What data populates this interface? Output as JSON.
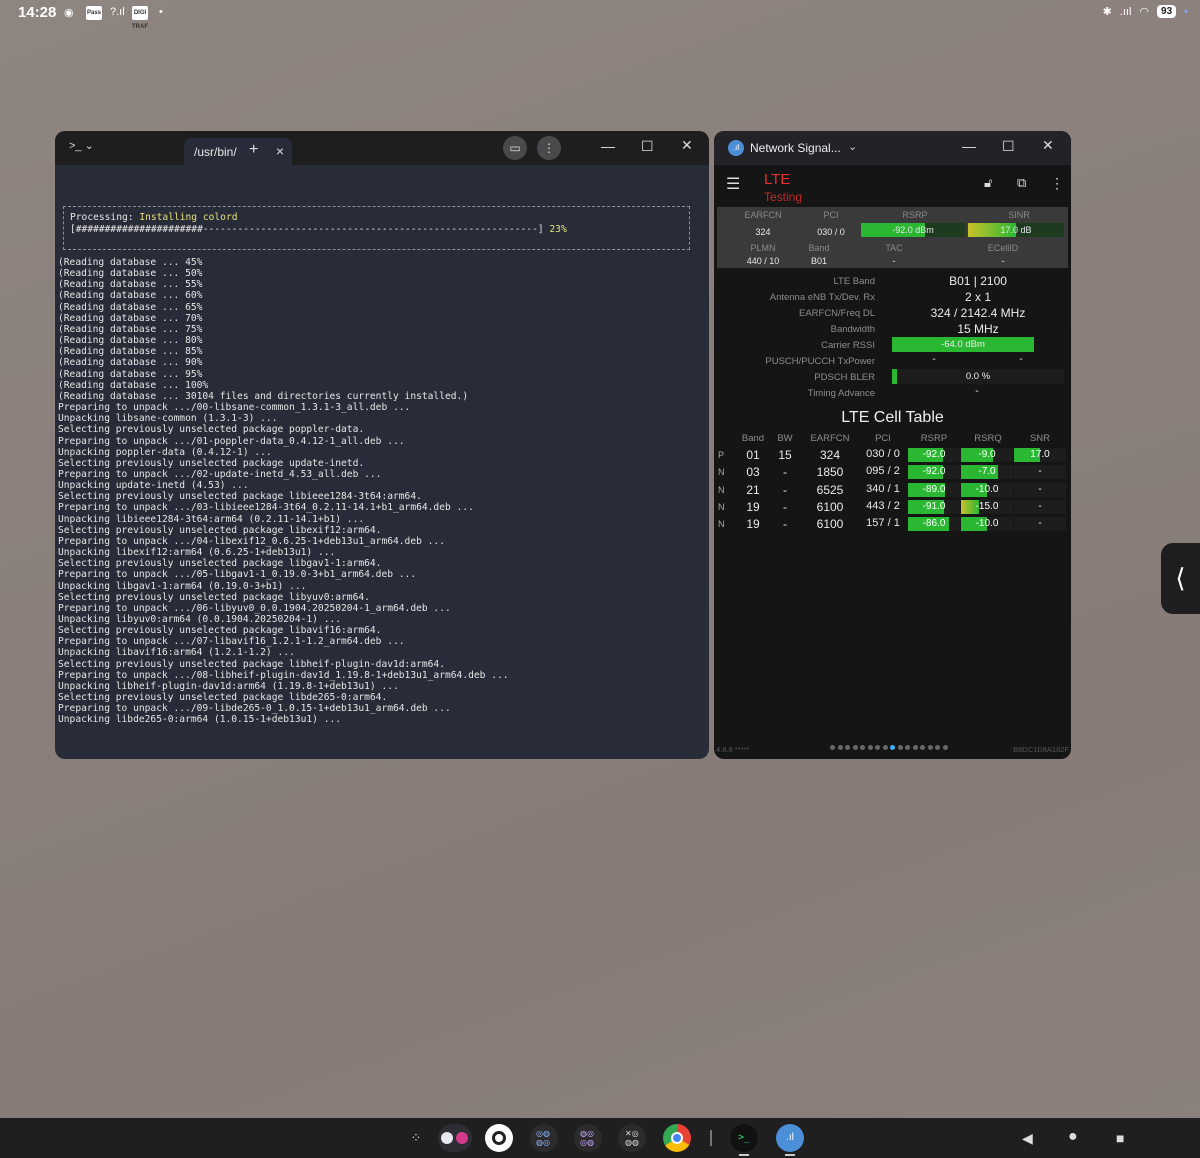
{
  "status_bar": {
    "time": "14:28",
    "battery": "93",
    "notif_labels": [
      "Pass",
      "DIGI\nTRAF"
    ]
  },
  "terminal": {
    "tab_label": "/usr/bin/",
    "new_tab": "+",
    "processing_label": "Processing: ",
    "processing_value": "Installing colord",
    "progress_bar": "[######################----------------------------------------------------------] ",
    "progress_pct": "23%",
    "log": "(Reading database ... 45%\n(Reading database ... 50%\n(Reading database ... 55%\n(Reading database ... 60%\n(Reading database ... 65%\n(Reading database ... 70%\n(Reading database ... 75%\n(Reading database ... 80%\n(Reading database ... 85%\n(Reading database ... 90%\n(Reading database ... 95%\n(Reading database ... 100%\n(Reading database ... 30104 files and directories currently installed.)\nPreparing to unpack .../00-libsane-common_1.3.1-3_all.deb ...\nUnpacking libsane-common (1.3.1-3) ...\nSelecting previously unselected package poppler-data.\nPreparing to unpack .../01-poppler-data_0.4.12-1_all.deb ...\nUnpacking poppler-data (0.4.12-1) ...\nSelecting previously unselected package update-inetd.\nPreparing to unpack .../02-update-inetd_4.53_all.deb ...\nUnpacking update-inetd (4.53) ...\nSelecting previously unselected package libieee1284-3t64:arm64.\nPreparing to unpack .../03-libieee1284-3t64_0.2.11-14.1+b1_arm64.deb ...\nUnpacking libieee1284-3t64:arm64 (0.2.11-14.1+b1) ...\nSelecting previously unselected package libexif12:arm64.\nPreparing to unpack .../04-libexif12_0.6.25-1+deb13u1_arm64.deb ...\nUnpacking libexif12:arm64 (0.6.25-1+deb13u1) ...\nSelecting previously unselected package libgav1-1:arm64.\nPreparing to unpack .../05-libgav1-1_0.19.0-3+b1_arm64.deb ...\nUnpacking libgav1-1:arm64 (0.19.0-3+b1) ...\nSelecting previously unselected package libyuv0:arm64.\nPreparing to unpack .../06-libyuv0_0.0.1904.20250204-1_arm64.deb ...\nUnpacking libyuv0:arm64 (0.0.1904.20250204-1) ...\nSelecting previously unselected package libavif16:arm64.\nPreparing to unpack .../07-libavif16_1.2.1-1.2_arm64.deb ...\nUnpacking libavif16:arm64 (1.2.1-1.2) ...\nSelecting previously unselected package libheif-plugin-dav1d:arm64.\nPreparing to unpack .../08-libheif-plugin-dav1d_1.19.8-1+deb13u1_arm64.deb ...\nUnpacking libheif-plugin-dav1d:arm64 (1.19.8-1+deb13u1) ...\nSelecting previously unselected package libde265-0:arm64.\nPreparing to unpack .../09-libde265-0_1.0.15-1+deb13u1_arm64.deb ...\nUnpacking libde265-0:arm64 (1.0.15-1+deb13u1) ..."
  },
  "netsignal": {
    "window_title": "Network Signal...",
    "tech": "LTE",
    "subtitle": "Testing",
    "summary": {
      "earfcn_h": "EARFCN",
      "earfcn": "324",
      "pci_h": "PCI",
      "pci": "030 / 0",
      "rsrp_h": "RSRP",
      "rsrp": "-92.0 dBm",
      "rsrp_level": 0.62,
      "sinr_h": "SINR",
      "sinr": "17.0 dB",
      "sinr_level": 0.5,
      "plmn_h": "PLMN",
      "plmn": "440 / 10",
      "band_h": "Band",
      "band": "B01",
      "tac_h": "TAC",
      "tac": "-",
      "ecellid_h": "ECellID",
      "ecellid": "-"
    },
    "details": {
      "lte_band_l": "LTE Band",
      "lte_band": "B01 | 2100",
      "antenna_l": "Antenna eNB Tx/Dev. Rx",
      "antenna": "2 x 1",
      "earfcn_l": "EARFCN/Freq DL",
      "earfcn": "324 / 2142.4 MHz",
      "bw_l": "Bandwidth",
      "bw": "15 MHz",
      "rssi_l": "Carrier RSSI",
      "rssi": "-64.0 dBm",
      "pusch_l": "PUSCH/PUCCH TxPower",
      "pusch_a": "-",
      "pusch_b": "-",
      "bler_l": "PDSCH BLER",
      "bler": "0.0 %",
      "ta_l": "Timing Advance",
      "ta": "-"
    },
    "cell_table": {
      "title": "LTE Cell Table",
      "headers": [
        "Band",
        "BW",
        "EARFCN",
        "PCI",
        "RSRP",
        "RSRQ",
        "SNR"
      ],
      "rows": [
        {
          "flag": "P",
          "band": "01",
          "bw": "15",
          "earfcn": "324",
          "pci": "030 / 0",
          "rsrp": "-92.0",
          "rsrp_level": 0.68,
          "rsrq": "-9.0",
          "rsrq_level": 0.62,
          "snr": "17.0",
          "snr_level": 0.5
        },
        {
          "flag": "N",
          "band": "03",
          "bw": "-",
          "earfcn": "1850",
          "pci": "095 / 2",
          "rsrp": "-92.0",
          "rsrp_level": 0.68,
          "rsrq": "-7.0",
          "rsrq_level": 0.72,
          "snr": "-",
          "snr_level": 0
        },
        {
          "flag": "N",
          "band": "21",
          "bw": "-",
          "earfcn": "6525",
          "pci": "340 / 1",
          "rsrp": "-89.0",
          "rsrp_level": 0.72,
          "rsrq": "-10.0",
          "rsrq_level": 0.5,
          "snr": "-",
          "snr_level": 0
        },
        {
          "flag": "N",
          "band": "19",
          "bw": "-",
          "earfcn": "6100",
          "pci": "443 / 2",
          "rsrp": "-91.0",
          "rsrp_level": 0.7,
          "rsrq": "-15.0",
          "rsrq_level": 0.35,
          "snr": "-",
          "snr_level": 0
        },
        {
          "flag": "N",
          "band": "19",
          "bw": "-",
          "earfcn": "6100",
          "pci": "157 / 1",
          "rsrp": "-86.0",
          "rsrp_level": 0.78,
          "rsrq": "-10.0",
          "rsrq_level": 0.5,
          "snr": "-",
          "snr_level": 0
        }
      ]
    },
    "footer_left": "4.8.8 *****",
    "footer_right": "B8DC1D8A182F",
    "page_dots": 16,
    "active_dot": 8
  },
  "colors": {
    "meter_green": "#2ab832",
    "meter_yellow": "#c9c22a",
    "accent_red": "#e53030"
  }
}
